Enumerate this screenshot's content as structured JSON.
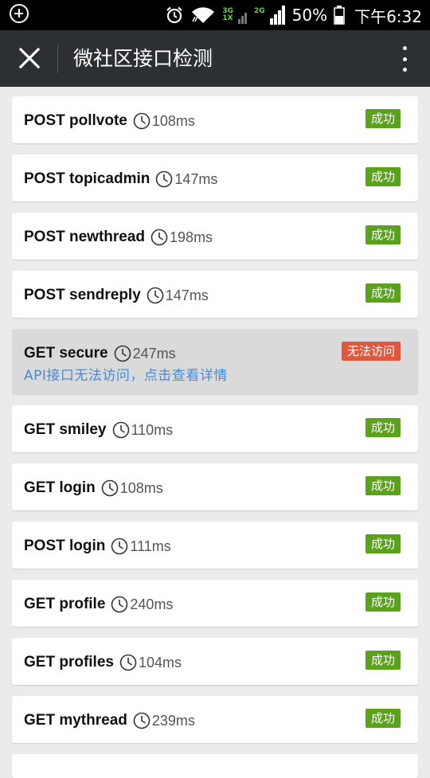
{
  "status_bar": {
    "battery_percent": "50%",
    "time": "下午6:32",
    "network_3g": "3G",
    "network_1x": "1X",
    "network_2g": "2G"
  },
  "header": {
    "title": "微社区接口检测"
  },
  "colors": {
    "header_bg": "#2d3033",
    "success": "#5aa21b",
    "failure": "#e2563c",
    "link": "#4a8ad6"
  },
  "items": [
    {
      "method_path": "POST pollvote",
      "time": "108ms",
      "status": "成功",
      "ok": true
    },
    {
      "method_path": "POST topicadmin",
      "time": "147ms",
      "status": "成功",
      "ok": true
    },
    {
      "method_path": "POST newthread",
      "time": "198ms",
      "status": "成功",
      "ok": true
    },
    {
      "method_path": "POST sendreply",
      "time": "147ms",
      "status": "成功",
      "ok": true
    },
    {
      "method_path": "GET secure",
      "time": "247ms",
      "status": "无法访问",
      "ok": false,
      "detail": "API接口无法访问，点击查看详情"
    },
    {
      "method_path": "GET smiley",
      "time": "110ms",
      "status": "成功",
      "ok": true
    },
    {
      "method_path": "GET login",
      "time": "108ms",
      "status": "成功",
      "ok": true
    },
    {
      "method_path": "POST login",
      "time": "111ms",
      "status": "成功",
      "ok": true
    },
    {
      "method_path": "GET profile",
      "time": "240ms",
      "status": "成功",
      "ok": true
    },
    {
      "method_path": "GET profiles",
      "time": "104ms",
      "status": "成功",
      "ok": true
    },
    {
      "method_path": "GET mythread",
      "time": "239ms",
      "status": "成功",
      "ok": true
    }
  ]
}
